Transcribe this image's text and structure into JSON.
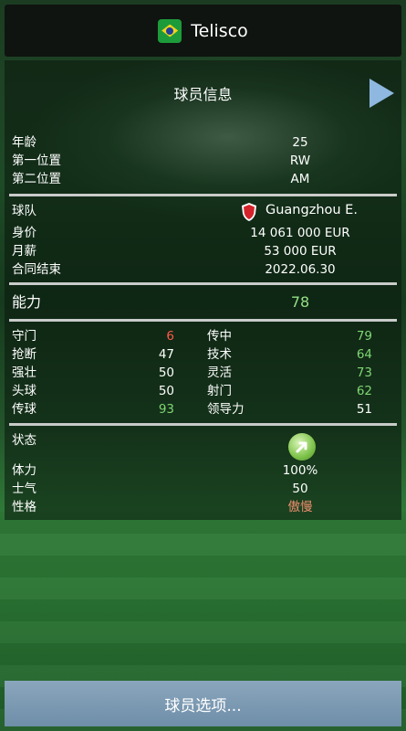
{
  "topbar": {
    "title": "Telisco",
    "flag_icon": "brazil-flag-icon"
  },
  "header": {
    "title": "球员信息",
    "next_icon": "play-arrow-icon"
  },
  "basic": [
    {
      "label": "年龄",
      "value": "25"
    },
    {
      "label": "第一位置",
      "value": "RW"
    },
    {
      "label": "第二位置",
      "value": "AM"
    }
  ],
  "club": {
    "team_label": "球队",
    "team_value": "Guangzhou E.",
    "rows": [
      {
        "label": "身价",
        "value": "14 061 000 EUR"
      },
      {
        "label": "月薪",
        "value": "53 000 EUR"
      },
      {
        "label": "合同结束",
        "value": "2022.06.30"
      }
    ]
  },
  "ability": {
    "label": "能力",
    "value": "78"
  },
  "attributes_left": [
    {
      "label": "守门",
      "value": "6",
      "color": "#ff5a48"
    },
    {
      "label": "抢断",
      "value": "47",
      "color": "#ffffff"
    },
    {
      "label": "强壮",
      "value": "50",
      "color": "#ffffff"
    },
    {
      "label": "头球",
      "value": "50",
      "color": "#ffffff"
    },
    {
      "label": "传球",
      "value": "93",
      "color": "#7fd673"
    }
  ],
  "attributes_right": [
    {
      "label": "传中",
      "value": "79",
      "color": "#7fd673"
    },
    {
      "label": "技术",
      "value": "64",
      "color": "#7fd673"
    },
    {
      "label": "灵活",
      "value": "73",
      "color": "#7fd673"
    },
    {
      "label": "射门",
      "value": "62",
      "color": "#7fd673"
    },
    {
      "label": "领导力",
      "value": "51",
      "color": "#ffffff"
    }
  ],
  "status": {
    "label": "状态",
    "icon": "trend-up-arrow-icon",
    "rows": [
      {
        "label": "体力",
        "value": "100%"
      },
      {
        "label": "士气",
        "value": "50"
      },
      {
        "label": "性格",
        "value": "傲慢"
      }
    ]
  },
  "footer": {
    "button_label": "球员选项..."
  }
}
